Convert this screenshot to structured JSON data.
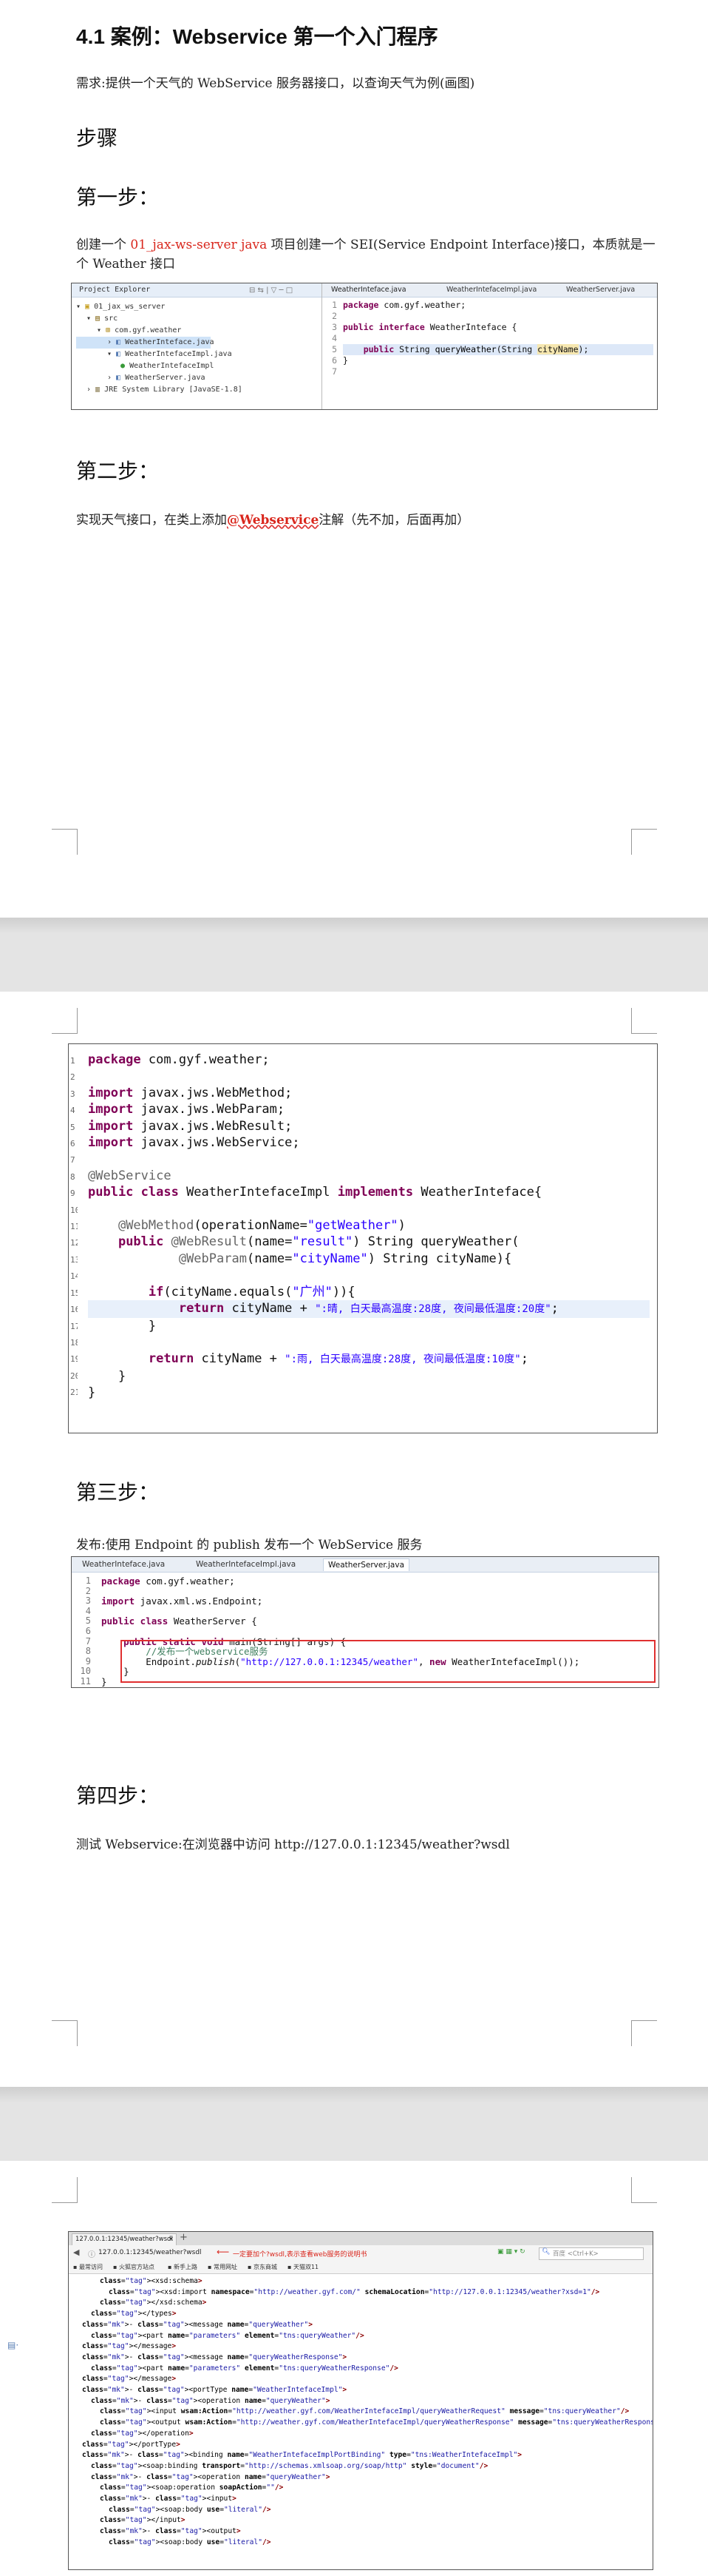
{
  "section_title": "4.1 案例：Webservice 第一个入门程序",
  "requirement": "需求:提供一个天气的 WebService 服务器接口，以查询天气为例(画图)",
  "steps_heading": "步骤",
  "step1": {
    "heading": "第一步：",
    "text_pre": "创建一个 ",
    "project_name": "01_jax-ws-server java",
    "text_post": " 项目创建一个 SEI(Service Endpoint Interface)接口，本质就是一个 Weather 接口"
  },
  "ide1": {
    "explorer_title": "Project Explorer",
    "tree": [
      "01_jax_ws_server",
      "src",
      "com.gyf.weather",
      "WeatherInteface.java",
      "WeatherIntefaceImpl.java",
      "WeatherIntefaceImpl",
      "WeatherServer.java",
      "JRE System Library [JavaSE-1.8]"
    ],
    "tabs": [
      "WeatherInteface.java",
      "WeatherIntefaceImpl.java",
      "WeatherServer.java"
    ],
    "line_numbers": [
      "1",
      "2",
      "3",
      "4",
      "5",
      "6",
      "7"
    ],
    "code": [
      "package com.gyf.weather;",
      "",
      "public interface WeatherInteface {",
      "",
      "    public String queryWeather(String cityName);",
      "}",
      ""
    ]
  },
  "step2": {
    "heading": "第二步：",
    "text_pre": "实现天气接口，在类上添加",
    "annotation": "@Webservice",
    "text_post": "注解（先不加，后面再加）"
  },
  "code2": {
    "line_numbers": [
      "1",
      "2",
      "3",
      "4",
      "5",
      "6",
      "7",
      "8",
      "9",
      "10",
      "11",
      "12",
      "13",
      "14",
      "15",
      "16",
      "17",
      "18",
      "19",
      "20",
      "21"
    ],
    "package_line": "package com.gyf.weather;",
    "imports": [
      "import javax.jws.WebMethod;",
      "import javax.jws.WebParam;",
      "import javax.jws.WebResult;",
      "import javax.jws.WebService;"
    ],
    "class_annotation": "@WebService",
    "class_decl": "public class WeatherIntefaceImpl implements WeatherInteface{",
    "method_annotation": "@WebMethod(operationName=\"getWeather\")",
    "method_sig_1": "public @WebResult(name=\"result\") String queryWeather(",
    "method_sig_2": "@WebParam(name=\"cityName\") String cityName){",
    "if_line": "if(cityName.equals(\"广州\")){",
    "return_1_pre": "return cityName + ",
    "return_1_str": "\":晴, 白天最高温度:28度, 夜间最低温度:20度\"",
    "close_if": "}",
    "return_2_pre": "return cityName + ",
    "return_2_str": "\":雨, 白天最高温度:28度, 夜间最低温度:10度\"",
    "close_method": "}",
    "close_class": "}"
  },
  "step3": {
    "heading": "第三步：",
    "text": "发布:使用 Endpoint 的 publish 发布一个 WebService 服务"
  },
  "ide3": {
    "tabs": [
      "WeatherInteface.java",
      "WeatherIntefaceImpl.java",
      "WeatherServer.java"
    ],
    "line_numbers": [
      "1",
      "2",
      "3",
      "4",
      "5",
      "6",
      "7",
      "8",
      "9",
      "10",
      "11"
    ],
    "code": [
      "package com.gyf.weather;",
      "",
      "import javax.xml.ws.Endpoint;",
      "",
      "public class WeatherServer {",
      "",
      "    public static void main(String[] args) {",
      "        //发布一个webservice服务",
      "        Endpoint.publish(\"http://127.0.0.1:12345/weather\", new WeatherIntefaceImpl());",
      "    }",
      "}"
    ]
  },
  "step4": {
    "heading": "第四步：",
    "text": "测试 Webservice:在浏览器中访问 http://127.0.0.1:12345/weather?wsdl"
  },
  "browser": {
    "tab_title": "127.0.0.1:12345/weather?wsdl",
    "address": "127.0.0.1:12345/weather?wsdl",
    "annotation": "一定要加个?wsdl,表示查看web服务的说明书",
    "search_placeholder": "百度 <Ctrl+K>",
    "bookmarks": [
      "最常访问",
      "火狐官方站点",
      "新手上路",
      "常用网址",
      "京东商城",
      "天猫双11"
    ],
    "xml_lines": [
      "<xsd:schema>",
      "<xsd:import namespace=\"http://weather.gyf.com/\" schemaLocation=\"http://127.0.0.1:12345/weather?xsd=1\"/>",
      "</xsd:schema>",
      "</types>",
      "- <message name=\"queryWeather\">",
      "<part name=\"parameters\" element=\"tns:queryWeather\"/>",
      "</message>",
      "- <message name=\"queryWeatherResponse\">",
      "<part name=\"parameters\" element=\"tns:queryWeatherResponse\"/>",
      "</message>",
      "- <portType name=\"WeatherIntefaceImpl\">",
      "- <operation name=\"queryWeather\">",
      "<input wsam:Action=\"http://weather.gyf.com/WeatherIntefaceImpl/queryWeatherRequest\" message=\"tns:queryWeather\"/>",
      "<output wsam:Action=\"http://weather.gyf.com/WeatherIntefaceImpl/queryWeatherResponse\" message=\"tns:queryWeatherResponse\"/>",
      "</operation>",
      "</portType>",
      "- <binding name=\"WeatherIntefaceImplPortBinding\" type=\"tns:WeatherIntefaceImpl\">",
      "<soap:binding transport=\"http://schemas.xmlsoap.org/soap/http\" style=\"document\"/>",
      "- <operation name=\"queryWeather\">",
      "<soap:operation soapAction=\"\"/>",
      "- <input>",
      "<soap:body use=\"literal\"/>",
      "</input>",
      "- <output>",
      "<soap:body use=\"literal\"/>"
    ]
  },
  "colors": {
    "keyword": "#7f0055",
    "annotation": "#646464",
    "string": "#2a00ff",
    "comment": "#3f7f5f",
    "highlight_red": "#d9261c",
    "gap": "#e4e4e4"
  }
}
